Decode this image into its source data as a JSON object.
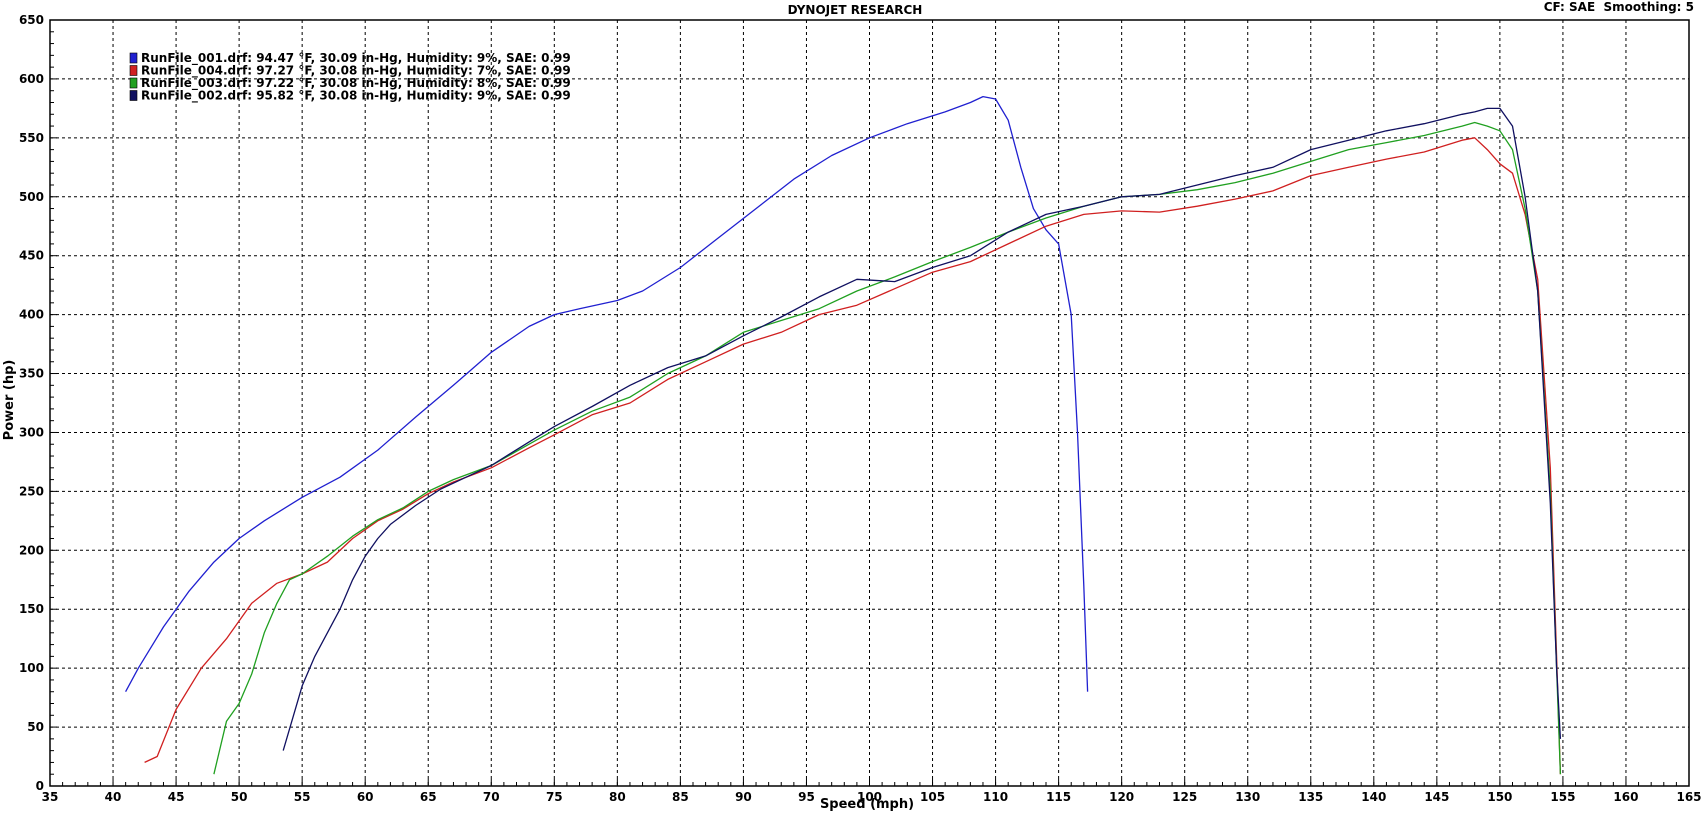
{
  "chart_data": {
    "type": "line",
    "title": "DYNOJET RESEARCH",
    "header_right": "CF: SAE  Smoothing: 5",
    "xlabel": "Speed (mph)",
    "ylabel": "Power (hp)",
    "xlim": [
      35,
      165
    ],
    "ylim": [
      0,
      650
    ],
    "x_ticks": [
      35,
      40,
      45,
      50,
      55,
      60,
      65,
      70,
      75,
      80,
      85,
      90,
      95,
      100,
      105,
      110,
      115,
      120,
      125,
      130,
      135,
      140,
      145,
      150,
      155,
      160,
      165
    ],
    "y_ticks": [
      0,
      50,
      100,
      150,
      200,
      250,
      300,
      350,
      400,
      450,
      500,
      550,
      600,
      650
    ],
    "grid": true,
    "legend_position": "top-left",
    "colors": {
      "axis": "#000000",
      "grid": "#000000",
      "background": "#ffffff"
    },
    "series": [
      {
        "name": "RunFile_001.drf: 94.47 °F, 30.09 in-Hg, Humidity: 9%, SAE: 0.99",
        "color": "#2020d0",
        "x": [
          41,
          42,
          44,
          46,
          48,
          50,
          52,
          55,
          58,
          61,
          64,
          67,
          70,
          73,
          75,
          77,
          80,
          82,
          85,
          88,
          91,
          94,
          97,
          100,
          103,
          106,
          108,
          109,
          110,
          111,
          112,
          113,
          114,
          115,
          116,
          116.5,
          117,
          117.3
        ],
        "y": [
          80,
          100,
          135,
          165,
          190,
          210,
          225,
          245,
          262,
          285,
          313,
          340,
          368,
          390,
          400,
          405,
          412,
          420,
          440,
          465,
          490,
          515,
          535,
          550,
          562,
          572,
          580,
          585,
          583,
          565,
          525,
          490,
          472,
          460,
          400,
          300,
          170,
          80
        ]
      },
      {
        "name": "RunFile_004.drf: 97.27 °F, 30.08 in-Hg, Humidity: 7%, SAE: 0.99",
        "color": "#d02020",
        "x": [
          42.5,
          43.5,
          45,
          47,
          49,
          51,
          53,
          55,
          57,
          59,
          61,
          63,
          65,
          67,
          70,
          73,
          75,
          78,
          81,
          84,
          87,
          90,
          93,
          96,
          99,
          102,
          105,
          108,
          111,
          114,
          117,
          120,
          123,
          126,
          129,
          132,
          135,
          138,
          141,
          144,
          147,
          148,
          149,
          150,
          151,
          152,
          153,
          154,
          154.5,
          154.8
        ],
        "y": [
          20,
          25,
          65,
          100,
          125,
          155,
          172,
          180,
          190,
          210,
          225,
          235,
          248,
          258,
          270,
          287,
          298,
          315,
          325,
          345,
          360,
          375,
          385,
          400,
          408,
          422,
          436,
          445,
          460,
          475,
          485,
          488,
          487,
          492,
          498,
          505,
          518,
          525,
          532,
          538,
          548,
          550,
          540,
          528,
          520,
          485,
          430,
          270,
          110,
          10
        ]
      },
      {
        "name": "RunFile_003.drf: 97.22 °F, 30.08 in-Hg, Humidity: 8%, SAE: 0.99",
        "color": "#20a020",
        "x": [
          48,
          49,
          50,
          51,
          52,
          53,
          54,
          55,
          57,
          59,
          61,
          63,
          65,
          67,
          70,
          73,
          75,
          78,
          81,
          84,
          87,
          90,
          93,
          96,
          99,
          102,
          105,
          108,
          111,
          114,
          117,
          120,
          123,
          126,
          129,
          132,
          135,
          138,
          141,
          144,
          147,
          148,
          149,
          150,
          151,
          152,
          153,
          154,
          154.5,
          154.8
        ],
        "y": [
          10,
          55,
          70,
          95,
          130,
          155,
          175,
          180,
          195,
          212,
          226,
          236,
          250,
          260,
          272,
          290,
          302,
          318,
          330,
          350,
          365,
          385,
          395,
          405,
          420,
          432,
          445,
          457,
          470,
          482,
          492,
          500,
          502,
          506,
          512,
          520,
          530,
          540,
          546,
          552,
          560,
          563,
          560,
          556,
          540,
          490,
          420,
          250,
          100,
          10
        ]
      },
      {
        "name": "RunFile_002.drf: 95.82 °F, 30.08 in-Hg, Humidity: 9%, SAE: 0.99",
        "color": "#101060",
        "x": [
          53.5,
          55,
          56,
          57,
          58,
          59,
          60,
          61,
          62,
          64,
          66,
          68,
          70,
          73,
          75,
          78,
          81,
          84,
          87,
          90,
          93,
          96,
          99,
          102,
          105,
          108,
          111,
          114,
          117,
          120,
          123,
          126,
          129,
          132,
          135,
          138,
          141,
          144,
          147,
          148,
          149,
          150,
          151,
          152,
          153,
          154,
          154.5,
          154.8
        ],
        "y": [
          30,
          85,
          110,
          130,
          150,
          175,
          195,
          210,
          222,
          238,
          252,
          262,
          272,
          292,
          305,
          322,
          340,
          355,
          365,
          382,
          398,
          415,
          430,
          428,
          440,
          450,
          470,
          485,
          492,
          500,
          502,
          510,
          518,
          525,
          540,
          548,
          556,
          562,
          570,
          572,
          575,
          575,
          560,
          500,
          420,
          240,
          100,
          40
        ]
      }
    ]
  }
}
